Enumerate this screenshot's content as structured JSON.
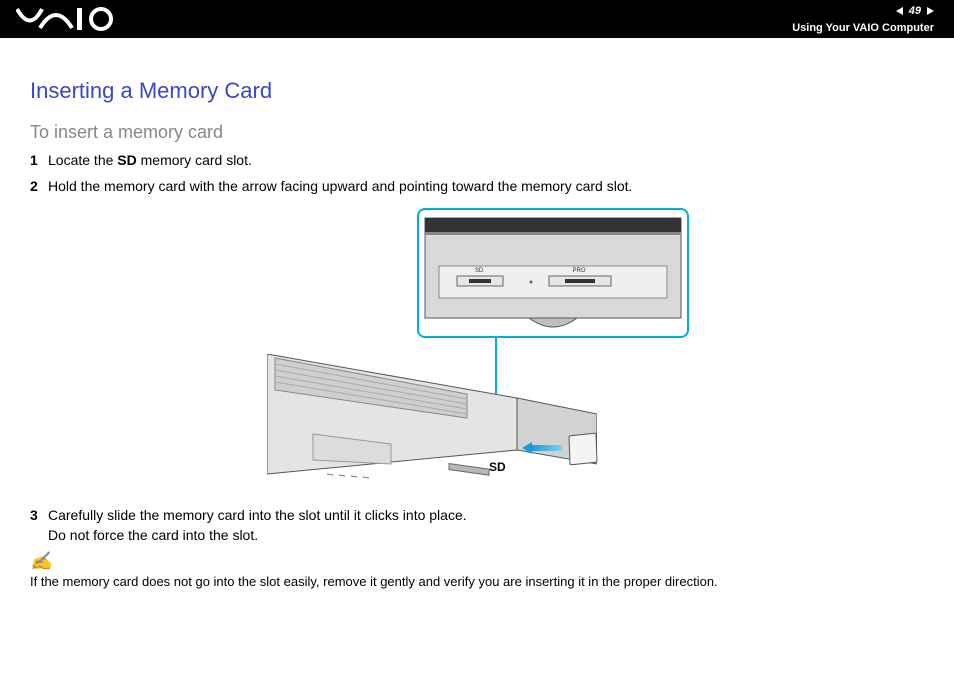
{
  "header": {
    "page_number": "49",
    "section": "Using Your VAIO Computer"
  },
  "title": "Inserting a Memory Card",
  "subtitle": "To insert a memory card",
  "steps": [
    {
      "n": "1",
      "pre": "Locate the ",
      "bold": "SD",
      "post": " memory card slot."
    },
    {
      "n": "2",
      "pre": "Hold the memory card with the arrow facing upward and pointing toward the memory card slot.",
      "bold": "",
      "post": ""
    },
    {
      "n": "3",
      "line1": "Carefully slide the memory card into the slot until it clicks into place.",
      "line2": "Do not force the card into the slot."
    }
  ],
  "figure": {
    "sd_label": "SD",
    "slot_sd_label": "SD",
    "slot_pro_label": "PRO"
  },
  "note": {
    "icon_glyph": "✍",
    "text": "If the memory card does not go into the slot easily, remove it gently and verify you are inserting it in the proper direction."
  }
}
